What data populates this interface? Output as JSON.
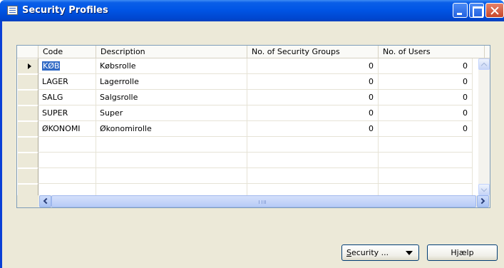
{
  "window": {
    "title": "Security Profiles",
    "icon": "table-form-icon",
    "accent": "#0055e5"
  },
  "grid": {
    "columns": [
      "Code",
      "Description",
      "No. of Security Groups",
      "No. of Users"
    ],
    "rows": [
      {
        "code": "KØB",
        "description": "Købsrolle",
        "groups": "0",
        "users": "0",
        "selected": true
      },
      {
        "code": "LAGER",
        "description": "Lagerrolle",
        "groups": "0",
        "users": "0"
      },
      {
        "code": "SALG",
        "description": "Salgsrolle",
        "groups": "0",
        "users": "0"
      },
      {
        "code": "SUPER",
        "description": "Super",
        "groups": "0",
        "users": "0"
      },
      {
        "code": "ØKONOMI",
        "description": "Økonomirolle",
        "groups": "0",
        "users": "0"
      }
    ],
    "selection_color": "#316ac5"
  },
  "buttons": {
    "security_first": "S",
    "security_rest": "ecurity ...",
    "help_label": "Hjælp"
  }
}
